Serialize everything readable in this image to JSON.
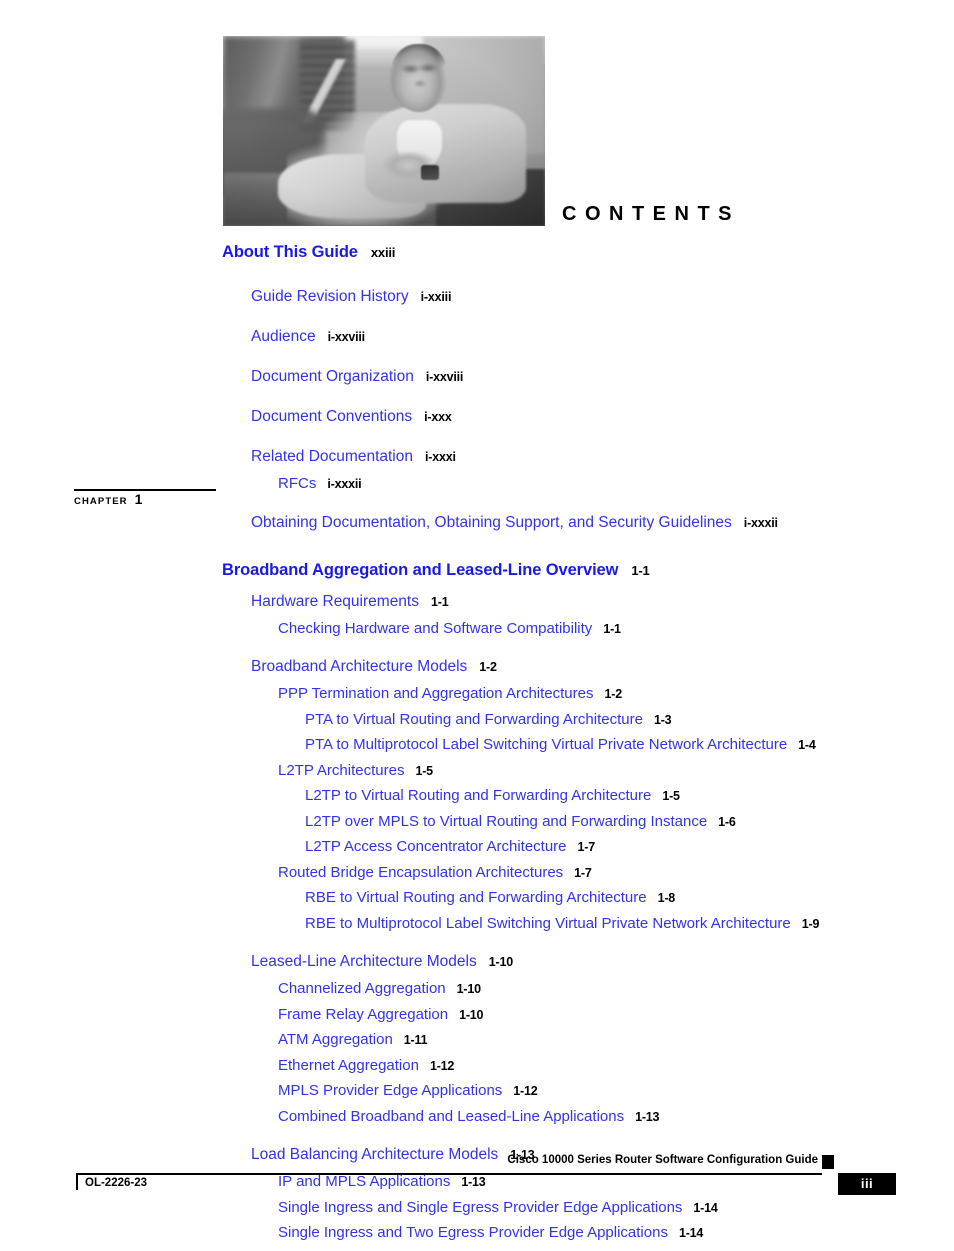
{
  "document": {
    "section_word": "CONTENTS",
    "cover_photo_alt": "man-seated-lobby-photo"
  },
  "chapter_marker": {
    "label": "CHAPTER",
    "number": "1"
  },
  "toc": {
    "entries": [
      {
        "level": "part",
        "title": "About This Guide",
        "page": "xxiii",
        "gap": "none"
      },
      {
        "level": "1",
        "title": "Guide Revision History",
        "page": "i-xxiii",
        "gap": "top"
      },
      {
        "level": "1",
        "title": "Audience",
        "page": "i-xxviii",
        "gap": "top"
      },
      {
        "level": "1",
        "title": "Document Organization",
        "page": "i-xxviii",
        "gap": "top"
      },
      {
        "level": "1",
        "title": "Document Conventions",
        "page": "i-xxx",
        "gap": "top"
      },
      {
        "level": "1",
        "title": "Related Documentation",
        "page": "i-xxxi",
        "gap": "top"
      },
      {
        "level": "2",
        "title": "RFCs",
        "page": "i-xxxii",
        "gap": "none"
      },
      {
        "level": "1",
        "title": "Obtaining Documentation, Obtaining Support, and Security Guidelines",
        "page": "i-xxxii",
        "gap": "top"
      },
      {
        "level": "part",
        "title": "Broadband Aggregation and Leased-Line Overview",
        "page": "1-1",
        "gap": "chapter"
      },
      {
        "level": "1",
        "title": "Hardware Requirements",
        "page": "1-1",
        "gap": "none"
      },
      {
        "level": "2",
        "title": "Checking Hardware and Software Compatibility",
        "page": "1-1",
        "gap": "none"
      },
      {
        "level": "1",
        "title": "Broadband Architecture Models",
        "page": "1-2",
        "gap": "top"
      },
      {
        "level": "2",
        "title": "PPP Termination and Aggregation Architectures",
        "page": "1-2",
        "gap": "none"
      },
      {
        "level": "3",
        "title": "PTA to Virtual Routing and Forwarding Architecture",
        "page": "1-3",
        "gap": "none"
      },
      {
        "level": "3",
        "title": "PTA to Multiprotocol Label Switching Virtual Private Network Architecture",
        "page": "1-4",
        "gap": "none"
      },
      {
        "level": "2",
        "title": "L2TP Architectures",
        "page": "1-5",
        "gap": "none"
      },
      {
        "level": "3",
        "title": "L2TP to Virtual Routing and Forwarding Architecture",
        "page": "1-5",
        "gap": "none"
      },
      {
        "level": "3",
        "title": "L2TP over MPLS to Virtual Routing and Forwarding Instance",
        "page": "1-6",
        "gap": "none"
      },
      {
        "level": "3",
        "title": "L2TP Access Concentrator Architecture",
        "page": "1-7",
        "gap": "none"
      },
      {
        "level": "2",
        "title": "Routed Bridge Encapsulation Architectures",
        "page": "1-7",
        "gap": "none"
      },
      {
        "level": "3",
        "title": "RBE to Virtual Routing and Forwarding Architecture",
        "page": "1-8",
        "gap": "none"
      },
      {
        "level": "3",
        "title": "RBE to Multiprotocol Label Switching Virtual Private Network Architecture",
        "page": "1-9",
        "gap": "none"
      },
      {
        "level": "1",
        "title": "Leased-Line Architecture Models",
        "page": "1-10",
        "gap": "top"
      },
      {
        "level": "2",
        "title": "Channelized Aggregation",
        "page": "1-10",
        "gap": "none"
      },
      {
        "level": "2",
        "title": "Frame Relay Aggregation",
        "page": "1-10",
        "gap": "none"
      },
      {
        "level": "2",
        "title": "ATM Aggregation",
        "page": "1-11",
        "gap": "none"
      },
      {
        "level": "2",
        "title": "Ethernet Aggregation",
        "page": "1-12",
        "gap": "none"
      },
      {
        "level": "2",
        "title": "MPLS Provider Edge Applications",
        "page": "1-12",
        "gap": "none"
      },
      {
        "level": "2",
        "title": "Combined Broadband and Leased-Line Applications",
        "page": "1-13",
        "gap": "none"
      },
      {
        "level": "1",
        "title": "Load Balancing Architecture Models",
        "page": "1-13",
        "gap": "top"
      },
      {
        "level": "2",
        "title": "IP and MPLS Applications",
        "page": "1-13",
        "gap": "none"
      },
      {
        "level": "2",
        "title": "Single Ingress and Single Egress Provider Edge Applications",
        "page": "1-14",
        "gap": "none"
      },
      {
        "level": "2",
        "title": "Single Ingress and Two Egress Provider Edge Applications",
        "page": "1-14",
        "gap": "none"
      }
    ]
  },
  "footer": {
    "doc_title": "Cisco 10000 Series Router Software Configuration Guide",
    "doc_id": "OL-2226-23",
    "page_number": "iii"
  },
  "colors": {
    "heading_blue": "#1A1AE8",
    "entry_blue": "#3333E6",
    "page_black": "#000000"
  }
}
